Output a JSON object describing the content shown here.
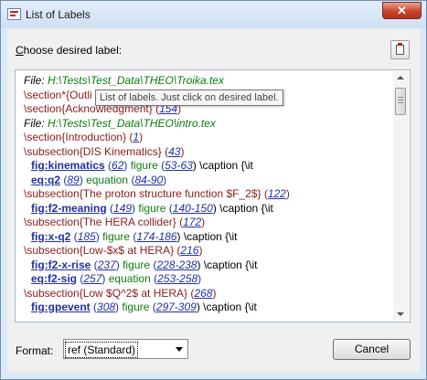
{
  "window": {
    "title": "List of Labels",
    "close_glyph": "✕"
  },
  "prompt": {
    "access_key": "C",
    "rest": "hoose desired label:"
  },
  "tooltip": "List of labels. Just click on desired label.",
  "format": {
    "label": "Format:",
    "selected": "ref (Standard)"
  },
  "cancel_label": "Cancel",
  "icons": {
    "app": "list-of-labels-icon",
    "clipboard": "clipboard-icon"
  },
  "lines": [
    {
      "segs": [
        {
          "t": "File: ",
          "c": "file"
        },
        {
          "t": "H:\\Tests\\Test_Data\\THEO\\Troika.tex",
          "c": "file path"
        }
      ]
    },
    {
      "segs": [
        {
          "t": "\\section*{Outli",
          "c": "sec"
        }
      ]
    },
    {
      "segs": [
        {
          "t": "\\section{Acknowledgment} (",
          "c": "sec"
        },
        {
          "t": "154",
          "c": "ref"
        },
        {
          "t": ")",
          "c": "sec"
        }
      ]
    },
    {
      "segs": [
        {
          "t": "File: ",
          "c": "file"
        },
        {
          "t": "H:\\Tests\\Test_Data\\THEO\\intro.tex",
          "c": "file path"
        }
      ]
    },
    {
      "segs": [
        {
          "t": "\\section{Introduction} (",
          "c": "sec"
        },
        {
          "t": "1",
          "c": "ref"
        },
        {
          "t": ")",
          "c": "sec"
        }
      ]
    },
    {
      "segs": [
        {
          "t": "\\subsection{DIS Kinematics} (",
          "c": "sec"
        },
        {
          "t": "43",
          "c": "ref"
        },
        {
          "t": ")",
          "c": "sec"
        }
      ]
    },
    {
      "segs": [
        {
          "t": "fig:kinematics",
          "c": "lbl"
        },
        {
          "t": " (",
          "c": "blue"
        },
        {
          "t": "62",
          "c": "ref"
        },
        {
          "t": ") ",
          "c": "blue"
        },
        {
          "t": "figure",
          "c": "grn"
        },
        {
          "t": " (",
          "c": "blue"
        },
        {
          "t": "53-63",
          "c": "ref"
        },
        {
          "t": ") \\caption {\\it",
          "c": ""
        }
      ]
    },
    {
      "segs": [
        {
          "t": "eq:q2",
          "c": "lbl"
        },
        {
          "t": " (",
          "c": "blue"
        },
        {
          "t": "89",
          "c": "ref"
        },
        {
          "t": ") ",
          "c": "blue"
        },
        {
          "t": "equation",
          "c": "grn"
        },
        {
          "t": " (",
          "c": "blue"
        },
        {
          "t": "84-90",
          "c": "ref"
        },
        {
          "t": ")",
          "c": "blue"
        }
      ]
    },
    {
      "segs": [
        {
          "t": "\\subsection{The proton structure function $F_2$} (",
          "c": "sec"
        },
        {
          "t": "122",
          "c": "ref"
        },
        {
          "t": ")",
          "c": "sec"
        }
      ]
    },
    {
      "segs": [
        {
          "t": "fig:f2-meaning",
          "c": "lbl"
        },
        {
          "t": " (",
          "c": "blue"
        },
        {
          "t": "149",
          "c": "ref"
        },
        {
          "t": ") ",
          "c": "blue"
        },
        {
          "t": "figure",
          "c": "grn"
        },
        {
          "t": " (",
          "c": "blue"
        },
        {
          "t": "140-150",
          "c": "ref"
        },
        {
          "t": ") \\caption {\\it",
          "c": ""
        }
      ]
    },
    {
      "segs": [
        {
          "t": "\\subsection{The HERA collider} (",
          "c": "sec"
        },
        {
          "t": "172",
          "c": "ref"
        },
        {
          "t": ")",
          "c": "sec"
        }
      ]
    },
    {
      "segs": [
        {
          "t": "fig:x-q2",
          "c": "lbl"
        },
        {
          "t": " (",
          "c": "blue"
        },
        {
          "t": "185",
          "c": "ref"
        },
        {
          "t": ") ",
          "c": "blue"
        },
        {
          "t": "figure",
          "c": "grn"
        },
        {
          "t": " (",
          "c": "blue"
        },
        {
          "t": "174-186",
          "c": "ref"
        },
        {
          "t": ") \\caption {\\it",
          "c": ""
        }
      ]
    },
    {
      "segs": [
        {
          "t": "\\subsection{Low-$x$ at HERA} (",
          "c": "sec"
        },
        {
          "t": "216",
          "c": "ref"
        },
        {
          "t": ")",
          "c": "sec"
        }
      ]
    },
    {
      "segs": [
        {
          "t": "fig:f2-x-rise",
          "c": "lbl"
        },
        {
          "t": " (",
          "c": "blue"
        },
        {
          "t": "237",
          "c": "ref"
        },
        {
          "t": ") ",
          "c": "blue"
        },
        {
          "t": "figure",
          "c": "grn"
        },
        {
          "t": " (",
          "c": "blue"
        },
        {
          "t": "228-238",
          "c": "ref"
        },
        {
          "t": ") \\caption {\\it",
          "c": ""
        }
      ]
    },
    {
      "segs": [
        {
          "t": "eq:f2-sig",
          "c": "lbl"
        },
        {
          "t": " (",
          "c": "blue"
        },
        {
          "t": "257",
          "c": "ref"
        },
        {
          "t": ") ",
          "c": "blue"
        },
        {
          "t": "equation",
          "c": "grn"
        },
        {
          "t": " (",
          "c": "blue"
        },
        {
          "t": "253-258",
          "c": "ref"
        },
        {
          "t": ")",
          "c": "blue"
        }
      ]
    },
    {
      "segs": [
        {
          "t": "\\subsection{Low $Q^2$ at HERA} (",
          "c": "sec"
        },
        {
          "t": "268",
          "c": "ref"
        },
        {
          "t": ")",
          "c": "sec"
        }
      ]
    },
    {
      "segs": [
        {
          "t": "fig:gpevent",
          "c": "lbl"
        },
        {
          "t": " (",
          "c": "blue"
        },
        {
          "t": "308",
          "c": "ref"
        },
        {
          "t": ") ",
          "c": "blue"
        },
        {
          "t": "figure",
          "c": "grn"
        },
        {
          "t": " (",
          "c": "blue"
        },
        {
          "t": "297-309",
          "c": "ref"
        },
        {
          "t": ") \\caption {\\it",
          "c": ""
        }
      ]
    }
  ]
}
